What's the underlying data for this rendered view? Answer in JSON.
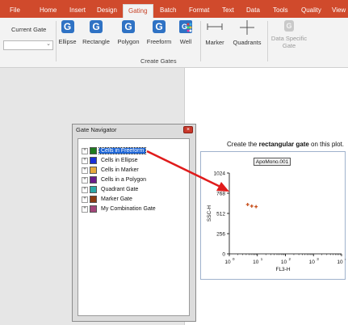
{
  "ribbon": {
    "tabs": [
      {
        "label": "File",
        "active": false
      },
      {
        "label": "Home",
        "active": false
      },
      {
        "label": "Insert",
        "active": false
      },
      {
        "label": "Design",
        "active": false
      },
      {
        "label": "Gating",
        "active": true
      },
      {
        "label": "Batch",
        "active": false
      },
      {
        "label": "Format",
        "active": false
      },
      {
        "label": "Text",
        "active": false
      },
      {
        "label": "Data",
        "active": false
      },
      {
        "label": "Tools",
        "active": false
      },
      {
        "label": "Quality",
        "active": false
      },
      {
        "label": "View",
        "active": false
      }
    ],
    "current_gate_label": "Current Gate",
    "current_gate_value": "",
    "gate_buttons": [
      {
        "label": "Ellipse",
        "icon": "gate-icon"
      },
      {
        "label": "Rectangle",
        "icon": "gate-icon"
      },
      {
        "label": "Polygon",
        "icon": "gate-icon"
      },
      {
        "label": "Freeform",
        "icon": "gate-icon"
      },
      {
        "label": "Well",
        "icon": "well-grid-icon"
      }
    ],
    "group_title": "Create Gates",
    "marker_label": "Marker",
    "quadrants_label": "Quadrants",
    "data_specific_label": "Data Specific Gate"
  },
  "gate_navigator": {
    "title": "Gate Navigator",
    "items": [
      {
        "label": "Cells in Freeform",
        "color": "#1f7a1f",
        "selected": true
      },
      {
        "label": "Cells in Ellipse",
        "color": "#1a2fd6",
        "selected": false
      },
      {
        "label": "Cells in Marker",
        "color": "#e7a93c",
        "selected": false
      },
      {
        "label": "Cells in a Polygon",
        "color": "#6a1b8a",
        "selected": false
      },
      {
        "label": "Quadrant Gate",
        "color": "#2aa7a7",
        "selected": false
      },
      {
        "label": "Marker Gate",
        "color": "#8b3a12",
        "selected": false
      },
      {
        "label": "My Combination Gate",
        "color": "#a3457a",
        "selected": false
      }
    ]
  },
  "instruction": {
    "prefix": "Create the ",
    "bold": "rectangular gate",
    "suffix": " on this plot."
  },
  "plot": {
    "title": "ApoMono.001"
  },
  "chart_data": {
    "type": "scatter",
    "title": "ApoMono.001",
    "xlabel": "FL3-H",
    "ylabel": "SSC-H",
    "xscale": "log",
    "xlim": [
      1,
      10000
    ],
    "x_ticks": [
      "10",
      "10",
      "10",
      "10",
      "10"
    ],
    "x_tick_exponents": [
      "0",
      "1",
      "2",
      "3",
      "4"
    ],
    "ylim": [
      0,
      1024
    ],
    "y_ticks": [
      "0",
      "256",
      "512",
      "768",
      "1024"
    ],
    "point_color": "#c8521f",
    "points": [
      {
        "x": 4.5,
        "y": 625
      },
      {
        "x": 6.3,
        "y": 605
      },
      {
        "x": 9.0,
        "y": 598
      }
    ]
  }
}
